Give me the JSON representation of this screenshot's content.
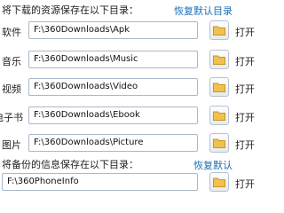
{
  "download_section": {
    "heading": "将下载的资源保存在以下目录：",
    "restore_label": "恢复默认目录"
  },
  "rows": [
    {
      "label": "软件",
      "path": "F:\\360Downloads\\Apk",
      "open_label": "打开"
    },
    {
      "label": "音乐",
      "path": "F:\\360Downloads\\Music",
      "open_label": "打开"
    },
    {
      "label": "视频",
      "path": "F:\\360Downloads\\Video",
      "open_label": "打开"
    },
    {
      "label": "电子书",
      "path": "F:\\360Downloads\\Ebook",
      "open_label": "打开"
    },
    {
      "label": "图片",
      "path": "F:\\360Downloads\\Picture",
      "open_label": "打开"
    }
  ],
  "backup_section": {
    "heading": "将备份的信息保存在以下目录：",
    "restore_label": "恢复默认",
    "path": "F:\\360PhoneInfo",
    "open_label": "打开"
  },
  "icons": {
    "folder": "folder-icon"
  },
  "colors": {
    "link": "#1a6fb5",
    "folder": "#f0c24d"
  }
}
